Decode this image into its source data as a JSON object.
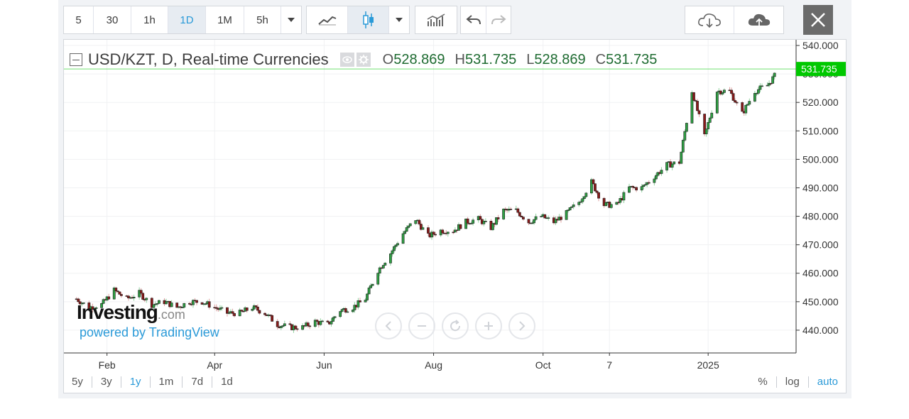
{
  "toolbar": {
    "intervals": [
      "5",
      "30",
      "1h",
      "1D",
      "1M",
      "5h"
    ],
    "active_interval": "1D"
  },
  "legend": {
    "title": "USD/KZT, D, Real-time Currencies",
    "open_key": "O",
    "open": "528.869",
    "high_key": "H",
    "high": "531.735",
    "low_key": "L",
    "low": "528.869",
    "close_key": "C",
    "close": "531.735"
  },
  "watermark": {
    "brand": "Investing",
    "suffix": ".com",
    "powered": "powered by TradingView"
  },
  "ranges": [
    "5y",
    "3y",
    "1y",
    "1m",
    "7d",
    "1d"
  ],
  "active_range": "1y",
  "scale_options": [
    "%",
    "log",
    "auto"
  ],
  "active_scale": "auto",
  "colors": {
    "up": "#2ea043",
    "down": "#8b1a1a",
    "accent": "#2a9ad8",
    "last_price": "#00c800"
  },
  "chart_data": {
    "type": "candlestick",
    "title": "USD/KZT, D, Real-time Currencies",
    "x_ticks": [
      "Feb",
      "Apr",
      "Jun",
      "Aug",
      "Oct",
      "7",
      "2025"
    ],
    "y_ticks": [
      "540.000",
      "530.000",
      "520.000",
      "510.000",
      "500.000",
      "490.000",
      "480.000",
      "470.000",
      "460.000",
      "450.000",
      "440.000"
    ],
    "ylim": [
      432,
      542
    ],
    "last_price": "531.735",
    "series": [
      {
        "x": "2024-01-15",
        "close": 451
      },
      {
        "x": "2024-01-22",
        "close": 448
      },
      {
        "x": "2024-01-29",
        "close": 449
      },
      {
        "x": "2024-02-05",
        "close": 454
      },
      {
        "x": "2024-02-12",
        "close": 451
      },
      {
        "x": "2024-02-19",
        "close": 453
      },
      {
        "x": "2024-02-26",
        "close": 449
      },
      {
        "x": "2024-03-04",
        "close": 450
      },
      {
        "x": "2024-03-11",
        "close": 448
      },
      {
        "x": "2024-03-18",
        "close": 450
      },
      {
        "x": "2024-03-25",
        "close": 450
      },
      {
        "x": "2024-04-01",
        "close": 448
      },
      {
        "x": "2024-04-08",
        "close": 446
      },
      {
        "x": "2024-04-15",
        "close": 446
      },
      {
        "x": "2024-04-22",
        "close": 448
      },
      {
        "x": "2024-04-29",
        "close": 446
      },
      {
        "x": "2024-05-06",
        "close": 442
      },
      {
        "x": "2024-05-13",
        "close": 441
      },
      {
        "x": "2024-05-20",
        "close": 441
      },
      {
        "x": "2024-05-27",
        "close": 443
      },
      {
        "x": "2024-06-03",
        "close": 442
      },
      {
        "x": "2024-06-10",
        "close": 447
      },
      {
        "x": "2024-06-17",
        "close": 448
      },
      {
        "x": "2024-06-24",
        "close": 451
      },
      {
        "x": "2024-07-01",
        "close": 461
      },
      {
        "x": "2024-07-08",
        "close": 467
      },
      {
        "x": "2024-07-15",
        "close": 474
      },
      {
        "x": "2024-07-22",
        "close": 479
      },
      {
        "x": "2024-07-29",
        "close": 473
      },
      {
        "x": "2024-08-05",
        "close": 475
      },
      {
        "x": "2024-08-12",
        "close": 475
      },
      {
        "x": "2024-08-19",
        "close": 478
      },
      {
        "x": "2024-08-26",
        "close": 479
      },
      {
        "x": "2024-09-02",
        "close": 476
      },
      {
        "x": "2024-09-09",
        "close": 482
      },
      {
        "x": "2024-09-16",
        "close": 482
      },
      {
        "x": "2024-09-23",
        "close": 478
      },
      {
        "x": "2024-09-30",
        "close": 480
      },
      {
        "x": "2024-10-07",
        "close": 478
      },
      {
        "x": "2024-10-14",
        "close": 481
      },
      {
        "x": "2024-10-21",
        "close": 485
      },
      {
        "x": "2024-10-28",
        "close": 492
      },
      {
        "x": "2024-11-04",
        "close": 484
      },
      {
        "x": "2024-11-11",
        "close": 484
      },
      {
        "x": "2024-11-18",
        "close": 490
      },
      {
        "x": "2024-11-25",
        "close": 490
      },
      {
        "x": "2024-12-02",
        "close": 494
      },
      {
        "x": "2024-12-09",
        "close": 498
      },
      {
        "x": "2024-12-16",
        "close": 499
      },
      {
        "x": "2024-12-23",
        "close": 524
      },
      {
        "x": "2024-12-30",
        "close": 508
      },
      {
        "x": "2025-01-06",
        "close": 524
      },
      {
        "x": "2025-01-13",
        "close": 524
      },
      {
        "x": "2025-01-20",
        "close": 516
      },
      {
        "x": "2025-01-27",
        "close": 524
      },
      {
        "x": "2025-02-03",
        "close": 526
      },
      {
        "x": "2025-02-10",
        "close": 531.735
      }
    ]
  }
}
